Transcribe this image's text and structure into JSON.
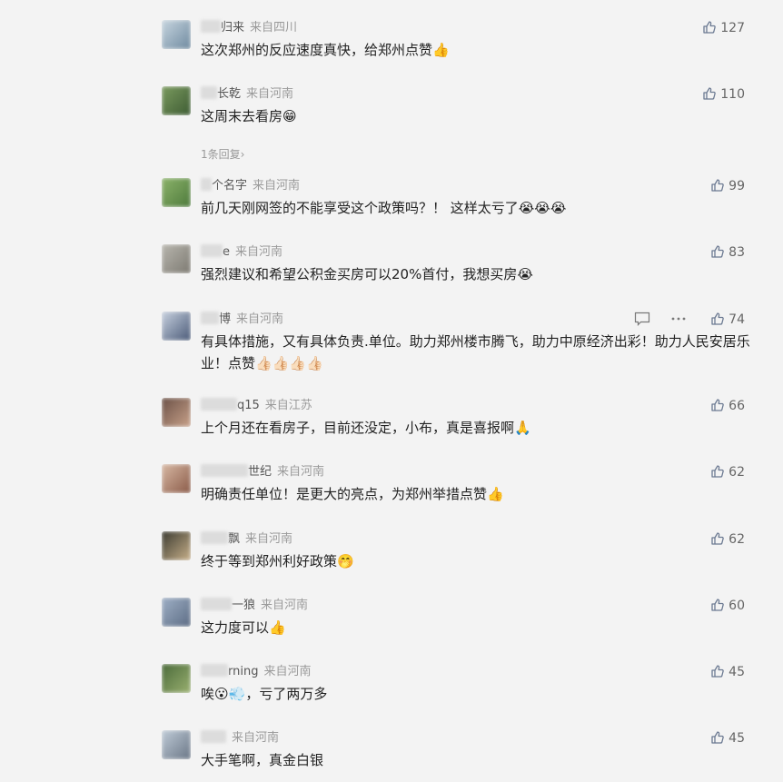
{
  "comments": [
    {
      "nick": "归来",
      "loc": "来自四川",
      "text": "这次郑州的反应速度真快，给郑州点赞",
      "emoji": "👍",
      "likes": "127",
      "av": [
        "#c8d6e0",
        "#6f8aa0"
      ],
      "mask": 22
    },
    {
      "nick": "长乾",
      "loc": "来自河南",
      "text": "这周末去看房",
      "emoji": "😁",
      "likes": "110",
      "av": [
        "#7a9a5e",
        "#3e5c34"
      ],
      "mask": 18,
      "reply": "1条回复"
    },
    {
      "nick": "个名字",
      "loc": "来自河南",
      "text": "前几天刚网签的不能享受这个政策吗？！ 这样太亏了",
      "emoji": "😭😭😭",
      "likes": "99",
      "av": [
        "#8cb36a",
        "#4d7a3c"
      ],
      "mask": 12
    },
    {
      "nick": "e",
      "loc": "来自河南",
      "text": "强烈建议和希望公积金买房可以20%首付，我想买房",
      "emoji": "😭",
      "likes": "83",
      "av": [
        "#b8b6ae",
        "#7d7a72"
      ],
      "mask": 24
    },
    {
      "nick": "博",
      "loc": "来自河南",
      "text": "有具体措施，又有具体负责.单位。助力郑州楼市腾飞，助力中原经济出彩！助力人民安居乐业！点赞",
      "emoji": "👍🏻👍🏻👍🏻👍🏻",
      "likes": "74",
      "av": [
        "#c9d2e0",
        "#4a5a78"
      ],
      "mask": 20,
      "tools": true
    },
    {
      "nick": "q15",
      "loc": "来自江苏",
      "text": "上个月还在看房子，目前还没定，小布，真是喜报啊",
      "emoji": "🙏",
      "likes": "66",
      "av": [
        "#6a5046",
        "#c9a28a"
      ],
      "mask": 40
    },
    {
      "nick": "世纪",
      "loc": "来自河南",
      "text": "明确责任单位！是更大的亮点，为郑州举措点赞",
      "emoji": "👍",
      "likes": "62",
      "av": [
        "#d8b9a4",
        "#8a5a48"
      ],
      "mask": 52
    },
    {
      "nick": "飘",
      "loc": "来自河南",
      "text": "终于等到郑州利好政策",
      "emoji": "🤭",
      "likes": "62",
      "av": [
        "#3a3a30",
        "#c8b08a"
      ],
      "mask": 30
    },
    {
      "nick": "一狼",
      "loc": "来自河南",
      "text": "这力度可以",
      "emoji": "👍",
      "likes": "60",
      "av": [
        "#9fb0c6",
        "#5c6c84"
      ],
      "mask": 34
    },
    {
      "nick": "rning",
      "loc": "来自河南",
      "text": "唉",
      "text2": "，亏了两万多",
      "emoji": "😮",
      "emoji2": "💨",
      "likes": "45",
      "av": [
        "#4a6a3a",
        "#9ab070"
      ],
      "mask": 30
    },
    {
      "nick": "",
      "loc": "来自河南",
      "text": "大手笔啊，真金白银",
      "emoji": "",
      "likes": "45",
      "av": [
        "#c0ccd8",
        "#6a7686"
      ],
      "mask": 28
    }
  ],
  "colors": {
    "bg": "#f3f3f3",
    "text": "#222222",
    "meta": "#9a9a9a",
    "icon": "#6c7a92"
  },
  "icons": {
    "like": "thumbs-up-icon",
    "comment": "comment-icon",
    "more": "more-dots-icon",
    "reply_arrow": "chevron-right-icon"
  }
}
